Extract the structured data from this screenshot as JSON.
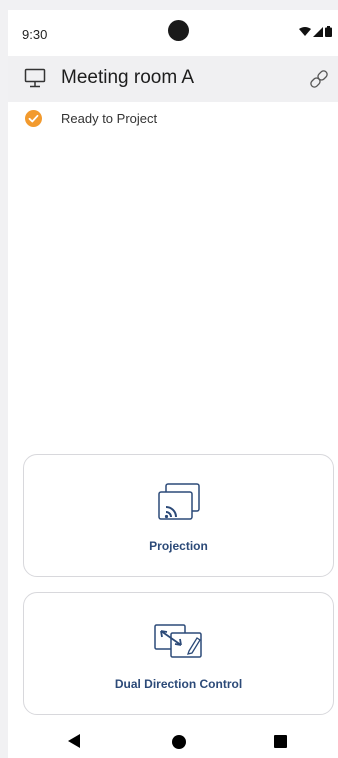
{
  "status_bar": {
    "time": "9:30",
    "icons": [
      "wifi-icon",
      "signal-icon",
      "battery-icon"
    ]
  },
  "header": {
    "title": "Meeting room A",
    "left_icon": "monitor-icon",
    "right_icon": "link-icon"
  },
  "status": {
    "text": "Ready to Project",
    "icon": "check-circle-icon",
    "color": "#f29a2e"
  },
  "cards": [
    {
      "label": "Projection",
      "icon": "cast-icon"
    },
    {
      "label": "Dual Direction Control",
      "icon": "dual-control-icon"
    }
  ],
  "nav": {
    "icons": [
      "back-icon",
      "home-icon",
      "recents-icon"
    ]
  },
  "colors": {
    "accent_text": "#2c4a78",
    "icon_stroke": "#2c4a78",
    "status_orange": "#f29a2e"
  }
}
